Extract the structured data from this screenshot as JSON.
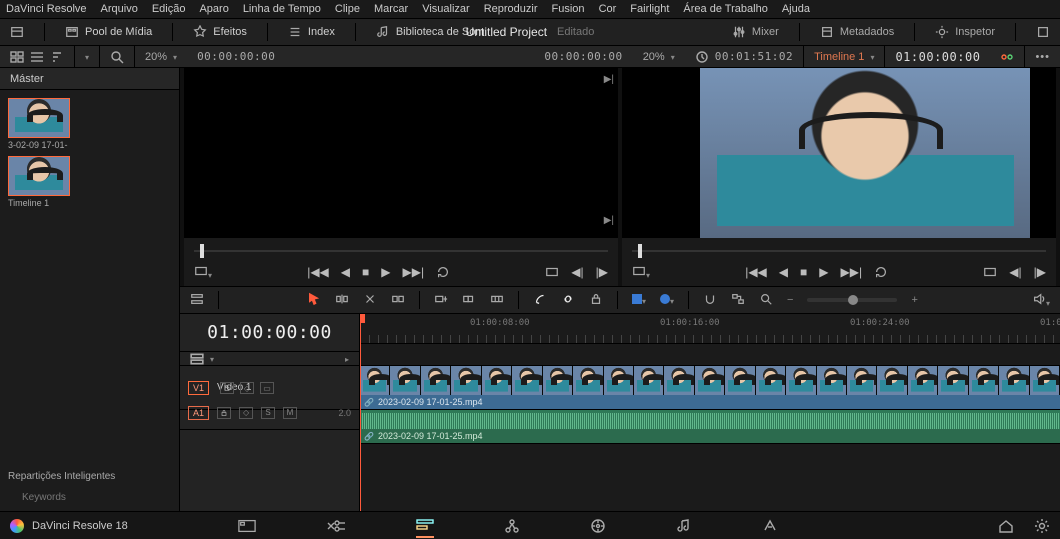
{
  "menu": [
    "DaVinci Resolve",
    "Arquivo",
    "Edição",
    "Aparo",
    "Linha de Tempo",
    "Clipe",
    "Marcar",
    "Visualizar",
    "Reproduzir",
    "Fusion",
    "Cor",
    "Fairlight",
    "Área de Trabalho",
    "Ajuda"
  ],
  "workspace": {
    "pool": "Pool de Mídia",
    "effects": "Efeitos",
    "index": "Index",
    "soundlib": "Biblioteca de Som",
    "mixer": "Mixer",
    "metadata": "Metadados",
    "inspector": "Inspetor"
  },
  "project": {
    "title": "Untitled Project",
    "state": "Editado"
  },
  "infobar": {
    "srcZoom": "20%",
    "srcTC": "00:00:00:00",
    "prgZoom": "20%",
    "prgIn": "00:00:00:00",
    "prgDur": "00:01:51:02",
    "timelineName": "Timeline 1",
    "recTC": "01:00:00:00"
  },
  "media": {
    "tab": "Máster",
    "clips": [
      {
        "caption": "3-02-09 17-01-"
      },
      {
        "caption": "Timeline 1"
      }
    ],
    "smart_header": "Repartições Inteligentes",
    "keywords": "Keywords"
  },
  "timeline": {
    "tc": "01:00:00:00",
    "ruler": [
      "01:00:08:00",
      "01:00:16:00",
      "01:00:24:00",
      "01:0"
    ],
    "video": {
      "tag": "V1",
      "name": "Vídeo 1",
      "clip": "2023-02-09 17-01-25.mp4"
    },
    "audio": {
      "tag": "A1",
      "clip": "2023-02-09 17-01-25.mp4",
      "scale": "2.0"
    }
  },
  "footer": {
    "brand": "DaVinci Resolve 18"
  }
}
